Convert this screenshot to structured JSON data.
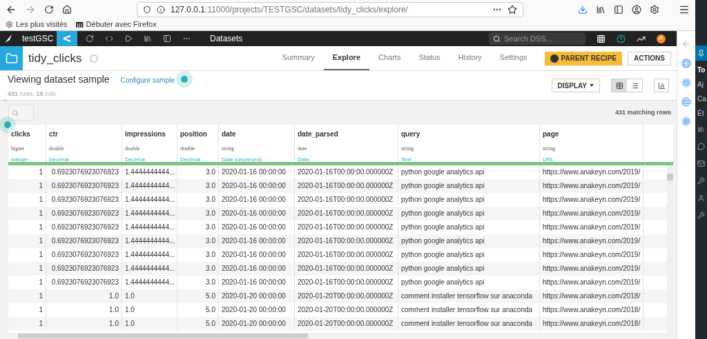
{
  "browser": {
    "url_host": "127.0.0.1",
    "url_path": ":11000/projects/TESTGSC/datasets/tidy_clicks/explore/",
    "bookmarks": [
      "Les plus visités",
      "Débuter avec Firefox"
    ]
  },
  "topnav": {
    "project": "testGSC",
    "section": "Datasets",
    "search_placeholder": "Search DSS...",
    "avatar": "A"
  },
  "dataset": {
    "name": "tidy_clicks"
  },
  "tabs": [
    {
      "label": "Summary",
      "selected": false
    },
    {
      "label": "Explore",
      "selected": true
    },
    {
      "label": "Charts",
      "selected": false
    },
    {
      "label": "Status",
      "selected": false
    },
    {
      "label": "History",
      "selected": false
    },
    {
      "label": "Settings",
      "selected": false
    }
  ],
  "parent_recipe": "PARENT RECIPE",
  "actions": "ACTIONS",
  "sample": {
    "title": "Viewing dataset sample",
    "configure": "Configure sample",
    "rows": "431",
    "rows_label": "rows,",
    "cols": "16",
    "cols_label": "cols"
  },
  "display": "DISPLAY",
  "view_mode": [
    {
      "kind": "grid",
      "selected": true
    },
    {
      "kind": "list",
      "selected": false
    }
  ],
  "matching": "431 matching rows",
  "columns": [
    {
      "name": "clicks",
      "storage": "bigint",
      "meaning": "Integer"
    },
    {
      "name": "ctr",
      "storage": "double",
      "meaning": "Decimal"
    },
    {
      "name": "impressions",
      "storage": "double",
      "meaning": "Decimal"
    },
    {
      "name": "position",
      "storage": "double",
      "meaning": "Decimal"
    },
    {
      "name": "date",
      "storage": "string",
      "meaning": "Date (unparsed)"
    },
    {
      "name": "date_parsed",
      "storage": "date",
      "meaning": "Date"
    },
    {
      "name": "query",
      "storage": "string",
      "meaning": "Text"
    },
    {
      "name": "page",
      "storage": "string",
      "meaning": "URL"
    }
  ],
  "rows": [
    [
      "1",
      "0.6923076923076923",
      "1.4444444444...",
      "3.0",
      "2020-01-16 00:00:00",
      "2020-01-16T00:00:00.000000Z",
      "python google analytics api",
      "https://www.anakeyn.com/2019/"
    ],
    [
      "1",
      "0.6923076923076923",
      "1.4444444444...",
      "3.0",
      "2020-01-16 00:00:00",
      "2020-01-16T00:00:00.000000Z",
      "python google analytics api",
      "https://www.anakeyn.com/2019/"
    ],
    [
      "1",
      "0.6923076923076923",
      "1.4444444444...",
      "3.0",
      "2020-01-16 00:00:00",
      "2020-01-16T00:00:00.000000Z",
      "python google analytics api",
      "https://www.anakeyn.com/2019/"
    ],
    [
      "1",
      "0.6923076923076923",
      "1.4444444444...",
      "3.0",
      "2020-01-16 00:00:00",
      "2020-01-16T00:00:00.000000Z",
      "python google analytics api",
      "https://www.anakeyn.com/2019/"
    ],
    [
      "1",
      "0.6923076923076923",
      "1.4444444444...",
      "3.0",
      "2020-01-16 00:00:00",
      "2020-01-16T00:00:00.000000Z",
      "python google analytics api",
      "https://www.anakeyn.com/2019/"
    ],
    [
      "1",
      "0.6923076923076923",
      "1.4444444444...",
      "3.0",
      "2020-01-16 00:00:00",
      "2020-01-16T00:00:00.000000Z",
      "python google analytics api",
      "https://www.anakeyn.com/2019/"
    ],
    [
      "1",
      "0.6923076923076923",
      "1.4444444444...",
      "3.0",
      "2020-01-16 00:00:00",
      "2020-01-16T00:00:00.000000Z",
      "python google analytics api",
      "https://www.anakeyn.com/2019/"
    ],
    [
      "1",
      "0.6923076923076923",
      "1.4444444444...",
      "3.0",
      "2020-01-16 00:00:00",
      "2020-01-16T00:00:00.000000Z",
      "python google analytics api",
      "https://www.anakeyn.com/2019/"
    ],
    [
      "1",
      "0.6923076923076923",
      "1.4444444444...",
      "3.0",
      "2020-01-16 00:00:00",
      "2020-01-16T00:00:00.000000Z",
      "python google analytics api",
      "https://www.anakeyn.com/2019/"
    ],
    [
      "1",
      "1.0",
      "1.0",
      "5.0",
      "2020-01-20 00:00:00",
      "2020-01-20T00:00:00.000000Z",
      "comment installer tensorflow sur anaconda",
      "https://www.anakeyn.com/2018/"
    ],
    [
      "1",
      "1.0",
      "1.0",
      "5.0",
      "2020-01-20 00:00:00",
      "2020-01-20T00:00:00.000000Z",
      "comment installer tensorflow sur anaconda",
      "https://www.anakeyn.com/2018/"
    ],
    [
      "1",
      "1.0",
      "1.0",
      "5.0",
      "2020-01-20 00:00:00",
      "2020-01-20T00:00:00.000000Z",
      "comment installer tensorflow sur anaconda",
      "https://www.anakeyn.com/2018/"
    ]
  ],
  "side_panel": [
    "To",
    "Aj",
    "Ca",
    "Ét"
  ]
}
